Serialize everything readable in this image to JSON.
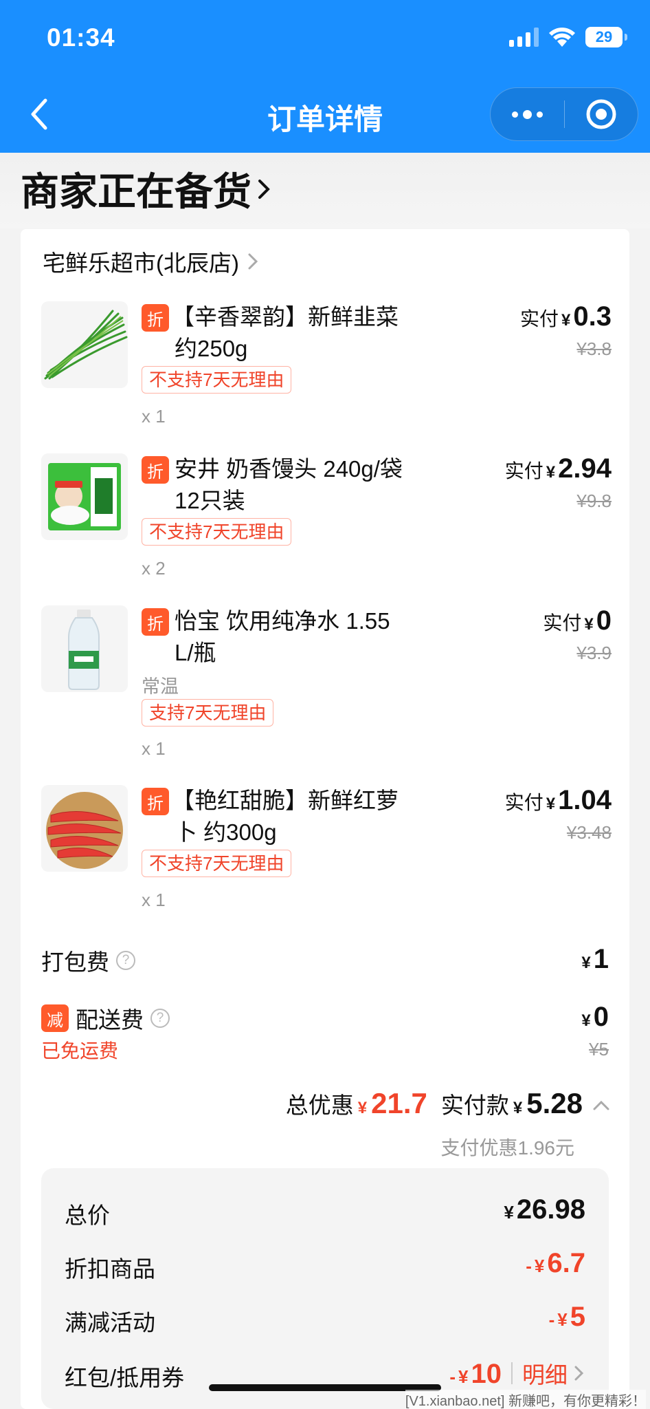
{
  "status_bar": {
    "time": "01:34",
    "battery": "29"
  },
  "nav": {
    "title": "订单详情"
  },
  "order_status": "商家正在备货",
  "shop": {
    "name": "宅鲜乐超市(北辰店)"
  },
  "items": [
    {
      "tag": "折",
      "name": "【辛香翠韵】新鲜韭菜约250g",
      "name_line1": "【辛香翠韵】新鲜韭菜",
      "name_line2": "约250g",
      "spec": "",
      "return_policy": "不支持7天无理由",
      "qty": "x 1",
      "paid_label": "实付",
      "currency": "¥",
      "paid": "0.3",
      "original": "¥3.8"
    },
    {
      "tag": "折",
      "name": "安井 奶香馒头 240g/袋 12只装",
      "name_line1": "安井 奶香馒头 240g/袋",
      "name_line2": "12只装",
      "spec": "",
      "return_policy": "不支持7天无理由",
      "qty": "x 2",
      "paid_label": "实付",
      "currency": "¥",
      "paid": "2.94",
      "original": "¥9.8"
    },
    {
      "tag": "折",
      "name": "怡宝 饮用纯净水 1.55 L/瓶",
      "name_line1": "怡宝 饮用纯净水 1.55",
      "name_line2": "L/瓶",
      "spec": "常温",
      "return_policy": "支持7天无理由",
      "qty": "x 1",
      "paid_label": "实付",
      "currency": "¥",
      "paid": "0",
      "original": "¥3.9"
    },
    {
      "tag": "折",
      "name": "【艳红甜脆】新鲜红萝卜 约300g",
      "name_line1": "【艳红甜脆】新鲜红萝",
      "name_line2": "卜 约300g",
      "spec": "",
      "return_policy": "不支持7天无理由",
      "qty": "x 1",
      "paid_label": "实付",
      "currency": "¥",
      "paid": "1.04",
      "original": "¥3.48"
    }
  ],
  "fees": {
    "packing": {
      "label": "打包费",
      "currency": "¥",
      "amount": "1"
    },
    "delivery": {
      "tag": "减",
      "label": "配送费",
      "note": "已免运费",
      "currency": "¥",
      "amount": "0",
      "original": "¥5"
    }
  },
  "summary": {
    "discount_label": "总优惠",
    "currency": "¥",
    "discount": "21.7",
    "paid_label": "实付款",
    "paid": "5.28",
    "payment_discount": "支付优惠1.96元"
  },
  "breakdown": [
    {
      "label": "总价",
      "sign": "",
      "currency": "¥",
      "amount": "26.98"
    },
    {
      "label": "折扣商品",
      "sign": "-",
      "currency": "¥",
      "amount": "6.7"
    },
    {
      "label": "满减活动",
      "sign": "-",
      "currency": "¥",
      "amount": "5"
    },
    {
      "label": "红包/抵用券",
      "sign": "-",
      "currency": "¥",
      "amount": "10",
      "link": "明细"
    }
  ],
  "watermark": "[V1.xianbao.net] 新赚吧，有你更精彩！",
  "colors": {
    "nav_blue": "#1a8fff",
    "accent_red": "#f0442a",
    "tag_orange": "#ff5a2b"
  }
}
